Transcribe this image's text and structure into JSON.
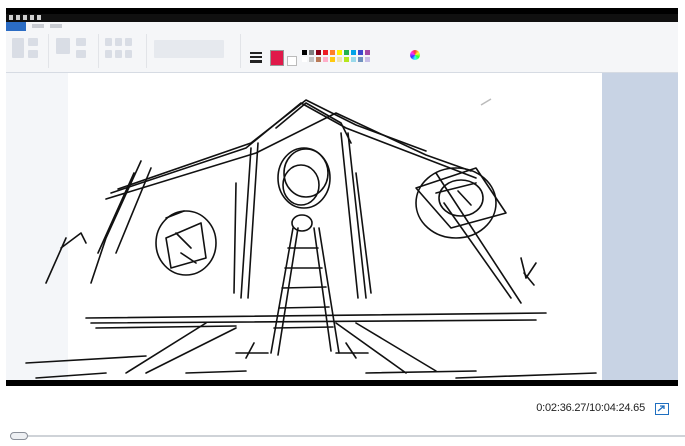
{
  "player": {
    "time_label": "0:02:36.27/10:04:24.65",
    "position_seconds": 156.27,
    "duration_seconds": 36264.65,
    "popout_icon": "popout-icon"
  },
  "paint": {
    "primary_color": "#e0194a",
    "secondary_color": "#ffffff",
    "palette_colors": [
      "#000000",
      "#7f7f7f",
      "#880015",
      "#ed1c24",
      "#ff7f27",
      "#fff200",
      "#22b14c",
      "#00a2e8",
      "#3f48cc",
      "#a349a4",
      "#ffffff",
      "#c3c3c3",
      "#b97a57",
      "#ffaec9",
      "#ffc90e",
      "#efe4b0",
      "#b5e61d",
      "#99d9ea",
      "#7092be",
      "#c8bfe7"
    ],
    "accent": "#2b6cc4"
  }
}
